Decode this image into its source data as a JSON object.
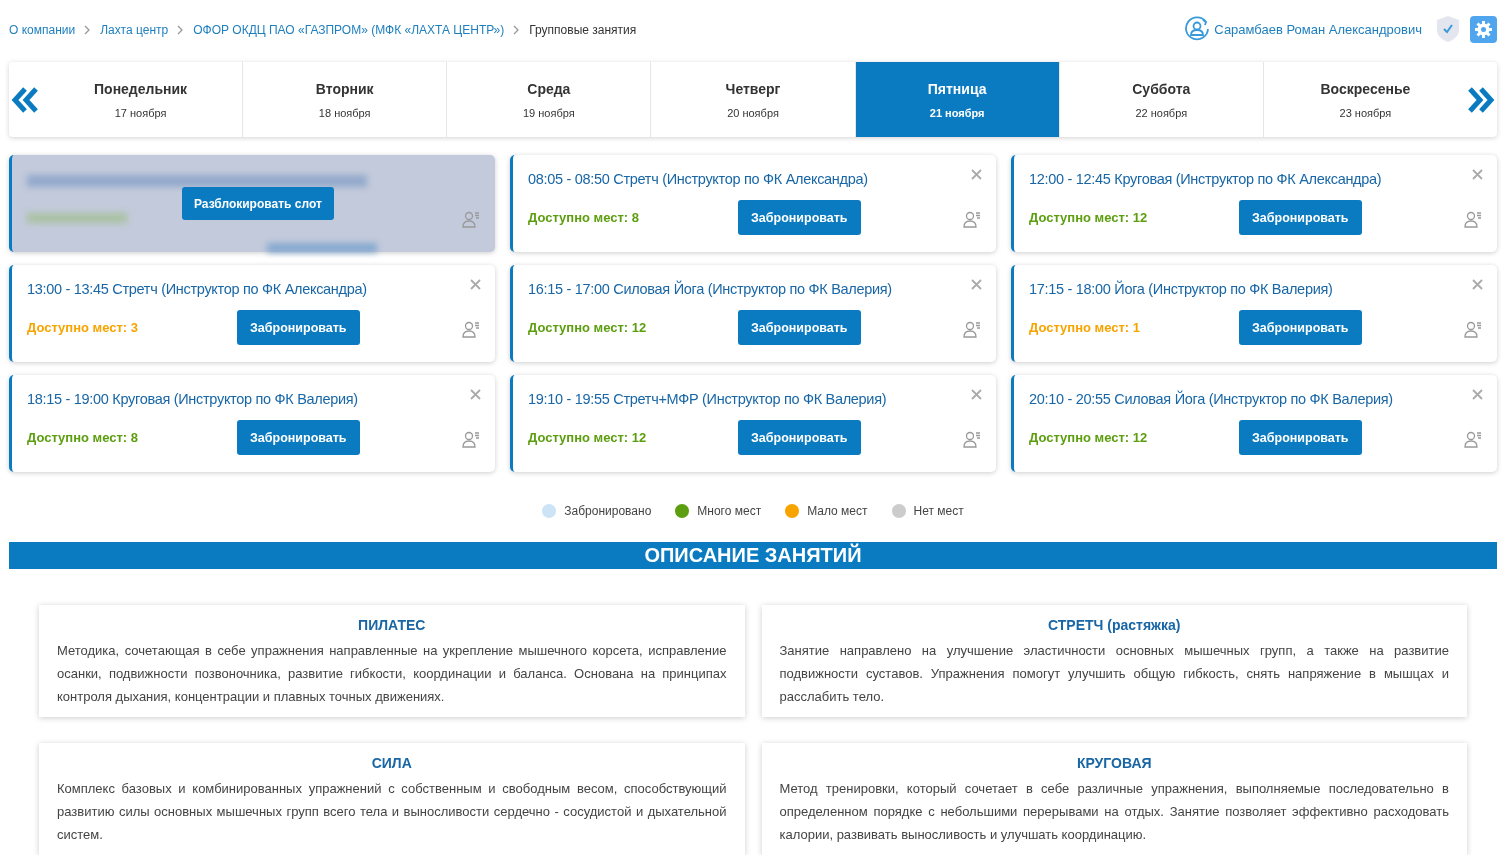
{
  "breadcrumbs": [
    {
      "label": "О компании",
      "link": true
    },
    {
      "label": "Лахта центр",
      "link": true
    },
    {
      "label": "ОФОР ОКДЦ ПАО «ГАЗПРОМ» (МФК «ЛАХТА ЦЕНТР»)",
      "link": true
    },
    {
      "label": "Групповые занятия",
      "link": false
    }
  ],
  "user": {
    "name": "Сарамбаев Роман Александрович"
  },
  "days": [
    {
      "name": "Понедельник",
      "date": "17 ноября",
      "selected": false
    },
    {
      "name": "Вторник",
      "date": "18 ноября",
      "selected": false
    },
    {
      "name": "Среда",
      "date": "19 ноября",
      "selected": false
    },
    {
      "name": "Четверг",
      "date": "20 ноября",
      "selected": false
    },
    {
      "name": "Пятница",
      "date": "21 ноября",
      "selected": true
    },
    {
      "name": "Суббота",
      "date": "22 ноября",
      "selected": false
    },
    {
      "name": "Воскресенье",
      "date": "23 ноября",
      "selected": false
    }
  ],
  "slots": [
    {
      "kind": "blocked",
      "action": "Разблокировать слот"
    },
    {
      "kind": "open",
      "title": "08:05 - 08:50 Стретч (Инструктор по ФК Александра)",
      "seats": "Доступно мест: 8",
      "color": "#5c9e0f",
      "action": "Забронировать"
    },
    {
      "kind": "open",
      "title": "12:00 - 12:45 Круговая (Инструктор по ФК Александра)",
      "seats": "Доступно мест: 12",
      "color": "#5c9e0f",
      "action": "Забронировать"
    },
    {
      "kind": "open",
      "title": "13:00 - 13:45 Стретч (Инструктор по ФК Александра)",
      "seats": "Доступно мест: 3",
      "color": "#f7a400",
      "action": "Забронировать"
    },
    {
      "kind": "open",
      "title": "16:15 - 17:00 Силовая Йога (Инструктор по ФК Валерия)",
      "seats": "Доступно мест: 12",
      "color": "#5c9e0f",
      "action": "Забронировать"
    },
    {
      "kind": "open",
      "title": "17:15 - 18:00 Йога (Инструктор по ФК Валерия)",
      "seats": "Доступно мест: 1",
      "color": "#f7a400",
      "action": "Забронировать"
    },
    {
      "kind": "open",
      "title": "18:15 - 19:00 Круговая (Инструктор по ФК Валерия)",
      "seats": "Доступно мест: 8",
      "color": "#5c9e0f",
      "action": "Забронировать"
    },
    {
      "kind": "open",
      "title": "19:10 - 19:55 Стретч+МФР (Инструктор по ФК Валерия)",
      "seats": "Доступно мест: 12",
      "color": "#5c9e0f",
      "action": "Забронировать"
    },
    {
      "kind": "open",
      "title": "20:10 - 20:55 Силовая Йога (Инструктор по ФК Валерия)",
      "seats": "Доступно мест: 12",
      "color": "#5c9e0f",
      "action": "Забронировать"
    }
  ],
  "legend": [
    {
      "label": "Забронировано",
      "color": "#cce4f6"
    },
    {
      "label": "Много мест",
      "color": "#5c9e0f"
    },
    {
      "label": "Мало мест",
      "color": "#f7a400"
    },
    {
      "label": "Нет мест",
      "color": "#cccccc"
    }
  ],
  "section_title": "ОПИСАНИЕ ЗАНЯТИЙ",
  "descriptions": [
    {
      "title": "ПИЛАТЕС",
      "text": "Методика, сочетающая в себе упражнения направленные на укрепление мышечного корсета, исправление осанки, подвижности позвоночника, развитие гибкости, координации и баланса. Основана на принципах контроля дыхания, концентрации и плавных точных движениях."
    },
    {
      "title": "СТРЕТЧ (растяжка)",
      "text": "Занятие направлено на улучшение эластичности основных мышечных групп, а также на развитие подвижности суставов. Упражнения помогут улучшить общую гибкость, снять напряжение в мышцах и расслабить тело."
    },
    {
      "title": "СИЛА",
      "text": "Комплекс базовых и комбинированных упражнений с собственным и свободным весом, способствующий развитию силы основных мышечных групп всего тела и выносливости сердечно - сосудистой и дыхательной систем."
    },
    {
      "title": "КРУГОВАЯ",
      "text": "Метод тренировки, который сочетает в себе различные упражнения, выполняемые последовательно в определенном порядке с небольшими перерывами на отдых. Занятие позволяет эффективно расходовать калории, развивать выносливость и улучшать координацию."
    }
  ]
}
